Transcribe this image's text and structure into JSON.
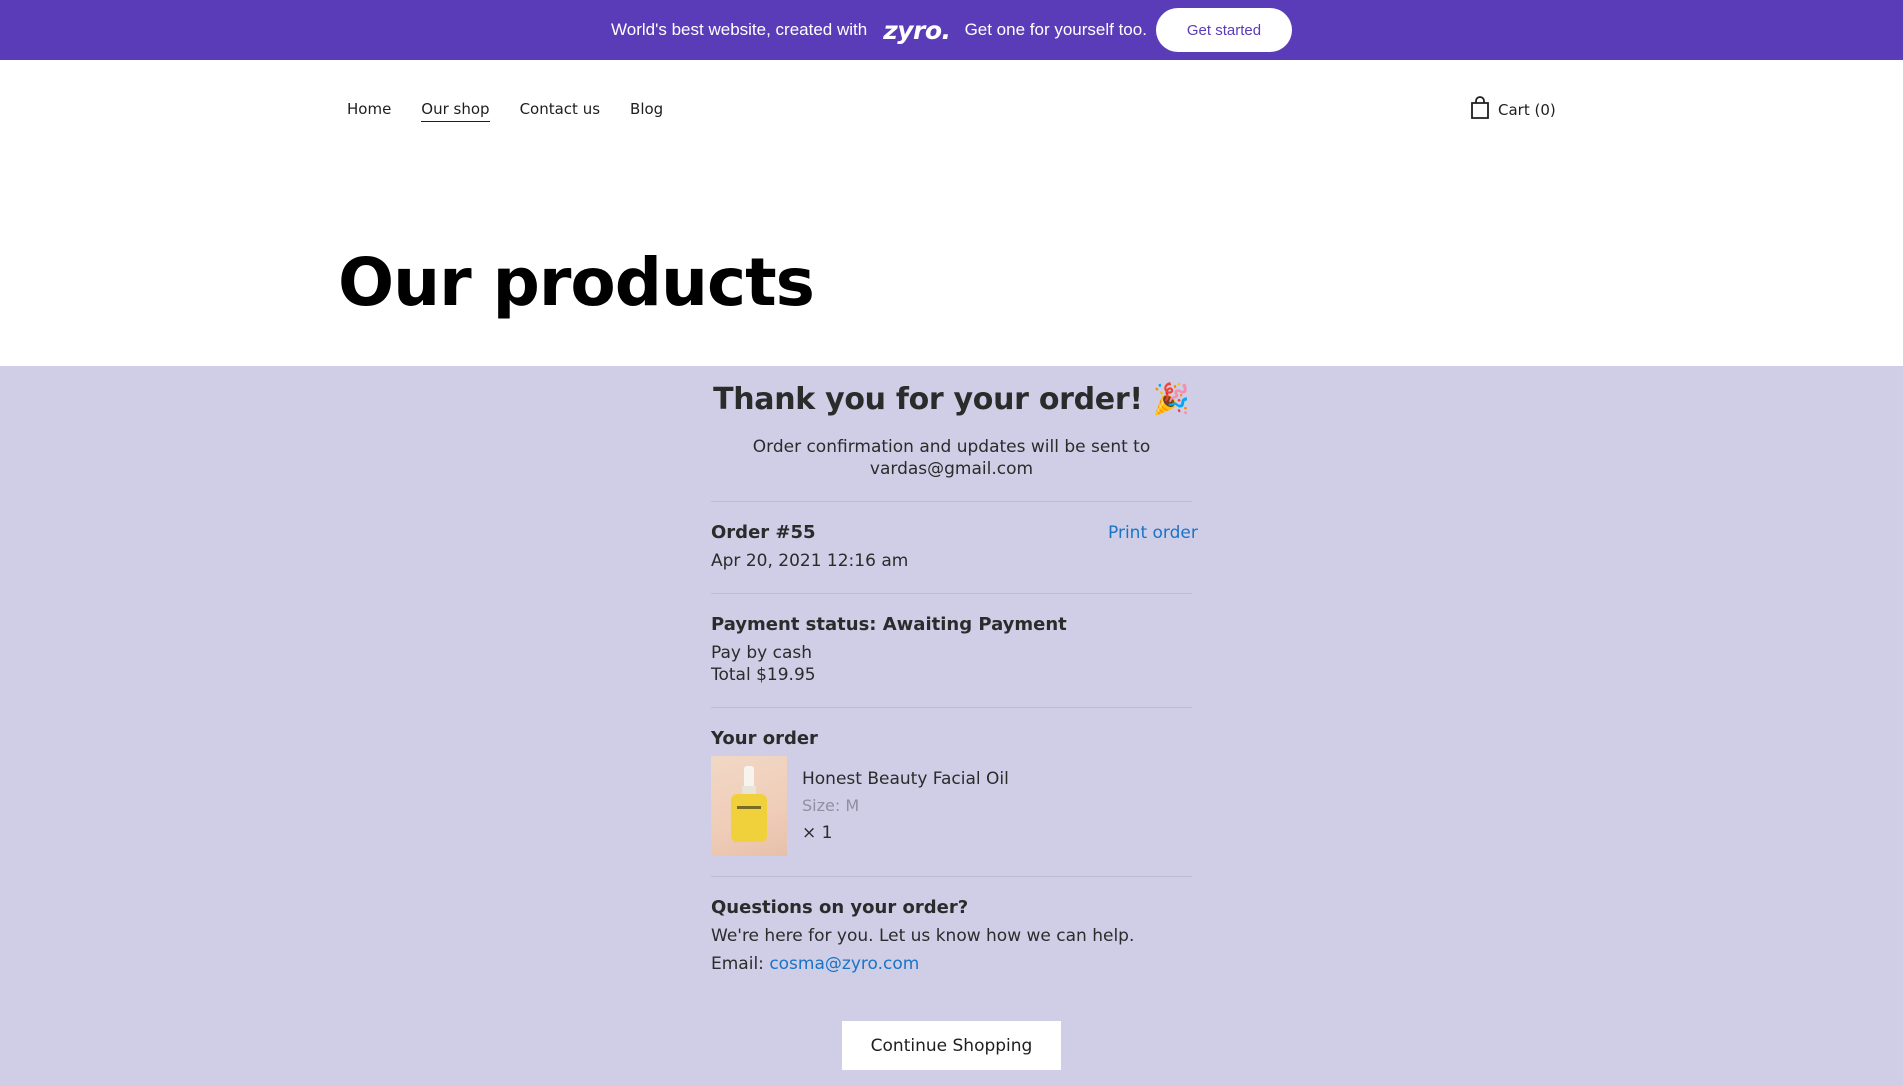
{
  "promo": {
    "text_before": "World's best website, created with",
    "logo": "zyro.",
    "text_after": "Get one for yourself too.",
    "button": "Get started"
  },
  "nav": {
    "items": [
      "Home",
      "Our shop",
      "Contact us",
      "Blog"
    ],
    "active": "Our shop",
    "cart_label": "Cart (0)"
  },
  "page_title": "Our products",
  "confirmation": {
    "heading": "Thank you for your order!",
    "emoji": "🎉",
    "message": "Order confirmation and updates will be sent to vardas@gmail.com",
    "order_number": "Order #55",
    "print_label": "Print order",
    "order_date": "Apr 20, 2021 12:16 am",
    "payment_status": "Payment status: Awaiting Payment",
    "payment_method": "Pay by cash",
    "total": "Total $19.95",
    "your_order_label": "Your order",
    "item": {
      "name": "Honest Beauty Facial Oil",
      "size": "Size: M",
      "quantity": "× 1"
    },
    "questions_heading": "Questions on your order?",
    "help_text": "We're here for you. Let us know how we can help.",
    "email_label": "Email:",
    "email": "cosma@zyro.com",
    "continue_button": "Continue Shopping"
  },
  "colors": {
    "promo_bg": "#5a3cb9",
    "order_bg": "#cfcee6",
    "link": "#1a73c7"
  }
}
